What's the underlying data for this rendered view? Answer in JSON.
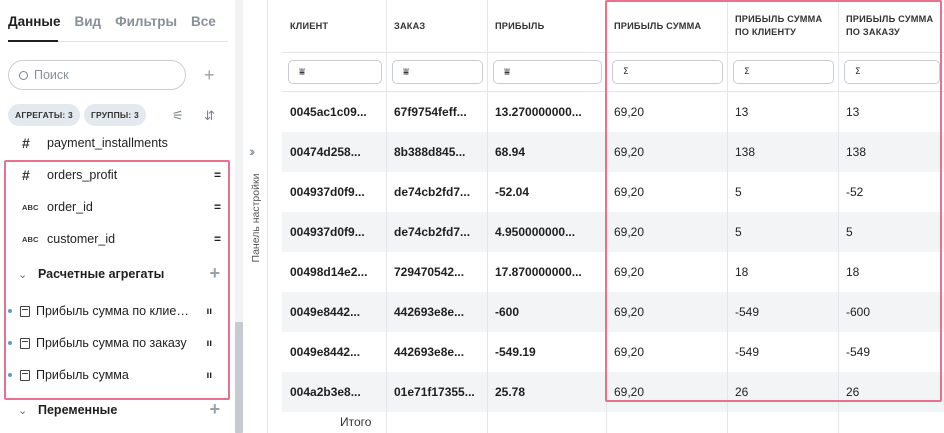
{
  "left_panel": {
    "tabs": [
      "Данные",
      "Вид",
      "Фильтры",
      "Все"
    ],
    "search_placeholder": "Поиск",
    "chips": {
      "aggregates": "АГРЕГАТЫ: 3",
      "groups": "ГРУППЫ: 3"
    },
    "fields": [
      {
        "type": "#",
        "name": "payment_installments"
      },
      {
        "type": "#",
        "name": "orders_profit"
      },
      {
        "type": "ABC",
        "name": "order_id"
      },
      {
        "type": "ABC",
        "name": "customer_id"
      }
    ],
    "section_calc": "Расчетные агрегаты",
    "aggregates": [
      "Прибыль сумма по клиенту",
      "Прибыль сумма по заказу",
      "Прибыль сумма"
    ],
    "section_vars": "Переменные"
  },
  "strip": {
    "label": "Панель настройки"
  },
  "table": {
    "headers": [
      "КЛИЕНТ",
      "ЗАКАЗ",
      "ПРИБЫЛЬ",
      "ПРИБЫЛЬ СУММА",
      "ПРИБЫЛЬ СУММА ПО КЛИЕНТУ",
      "ПРИБЫЛЬ СУММА ПО ЗАКАЗУ"
    ],
    "rows": [
      [
        "0045ac1c09...",
        "67f9754feff...",
        "13.270000000...",
        "69,20",
        "13",
        "13"
      ],
      [
        "00474d258...",
        "8b388d845...",
        "68.94",
        "69,20",
        "138",
        "138"
      ],
      [
        "004937d0f9...",
        "de74cb2fd7...",
        "-52.04",
        "69,20",
        "5",
        "-52"
      ],
      [
        "004937d0f9...",
        "de74cb2fd7...",
        "4.950000000...",
        "69,20",
        "5",
        "5"
      ],
      [
        "00498d14e2...",
        "729470542...",
        "17.870000000...",
        "69,20",
        "18",
        "18"
      ],
      [
        "0049e8442...",
        "442693e8e...",
        "-600",
        "69,20",
        "-549",
        "-600"
      ],
      [
        "0049e8442...",
        "442693e8e...",
        "-549.19",
        "69,20",
        "-549",
        "-549"
      ],
      [
        "004a2b3e8...",
        "01e71f17355...",
        "25.78",
        "69,20",
        "26",
        "26"
      ]
    ],
    "total_label": "Итого"
  },
  "colors": {
    "highlight": "#e8718f",
    "accent_dot": "#5b9bd5"
  }
}
